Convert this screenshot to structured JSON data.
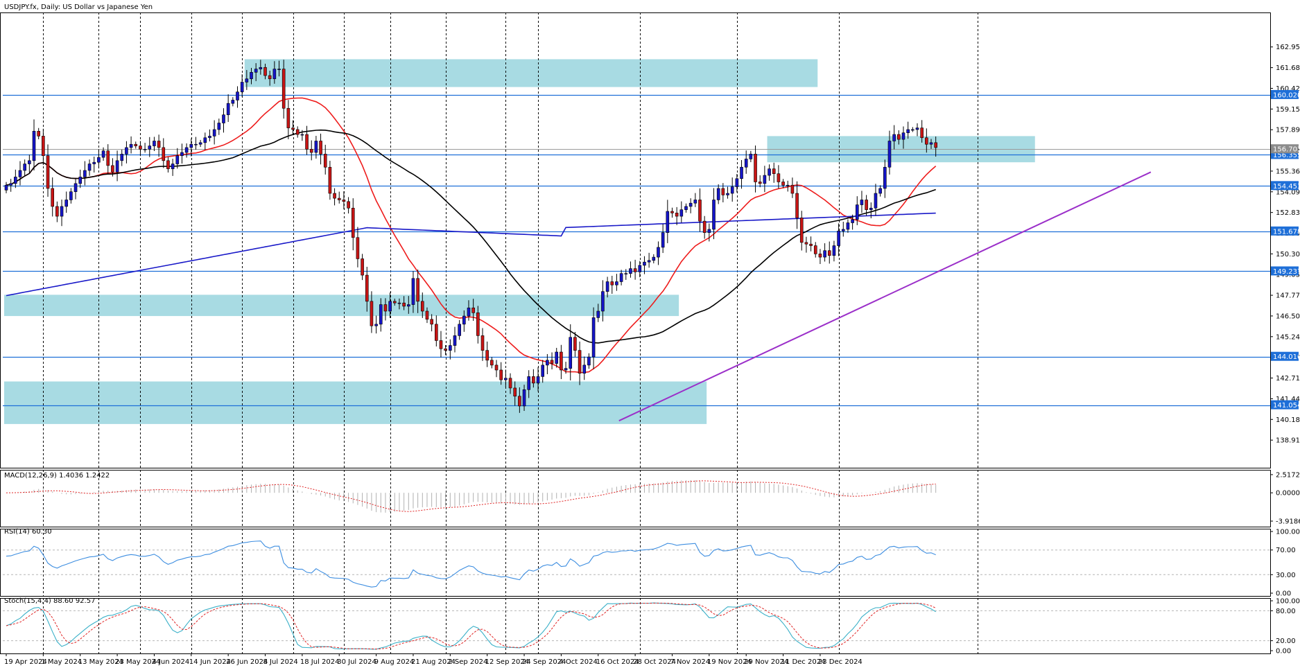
{
  "title": "USDJPY.fx, Daily:  US Dollar vs Japanese Yen",
  "colors": {
    "bull": "#1515c8",
    "bear": "#c81515",
    "zone": "#a8dbe3",
    "level": "#1e6fd8",
    "ma_fast": "#ee1c1c",
    "ma_mid": "#000000",
    "ma_slow": "#1818c8",
    "trend": "#9b2fc9",
    "rsi": "#3c8de0",
    "stoch_main": "#3ab0c8",
    "stoch_signal": "#e02424",
    "macd_hist": "#b0b0b0",
    "macd_signal": "#e02424"
  },
  "chart_data": {
    "type": "candlestick",
    "symbol": "USDJPY.fx",
    "timeframe": "Daily",
    "ylim": [
      137.65,
      164.21
    ],
    "y_ticks": [
      "162.950",
      "161.685",
      "160.420",
      "159.155",
      "157.890",
      "156.625",
      "155.360",
      "154.095",
      "152.830",
      "151.565",
      "150.300",
      "149.035",
      "147.770",
      "146.505",
      "145.240",
      "143.975",
      "142.710",
      "141.445",
      "140.180",
      "138.915"
    ],
    "x_labels": [
      {
        "i": 0,
        "label": "19 Apr 2024"
      },
      {
        "i": 8,
        "label": "1 May 2024"
      },
      {
        "i": 16,
        "label": "13 May 2024"
      },
      {
        "i": 24,
        "label": "23 May 2024"
      },
      {
        "i": 32,
        "label": "4 Jun 2024"
      },
      {
        "i": 40,
        "label": "14 Jun 2024"
      },
      {
        "i": 48,
        "label": "26 Jun 2024"
      },
      {
        "i": 56,
        "label": "8 Jul 2024"
      },
      {
        "i": 64,
        "label": "18 Jul 2024"
      },
      {
        "i": 72,
        "label": "30 Jul 2024"
      },
      {
        "i": 80,
        "label": "9 Aug 2024"
      },
      {
        "i": 88,
        "label": "21 Aug 2024"
      },
      {
        "i": 96,
        "label": "2 Sep 2024"
      },
      {
        "i": 104,
        "label": "12 Sep 2024"
      },
      {
        "i": 112,
        "label": "24 Sep 2024"
      },
      {
        "i": 120,
        "label": "4 Oct 2024"
      },
      {
        "i": 128,
        "label": "16 Oct 2024"
      },
      {
        "i": 136,
        "label": "28 Oct 2024"
      },
      {
        "i": 144,
        "label": "7 Nov 2024"
      },
      {
        "i": 152,
        "label": "19 Nov 2024"
      },
      {
        "i": 160,
        "label": "29 Nov 2024"
      },
      {
        "i": 168,
        "label": "11 Dec 2024"
      },
      {
        "i": 176,
        "label": "23 Dec 2024"
      }
    ],
    "vgrid_i": [
      8,
      20,
      29,
      40,
      51,
      62,
      73,
      83,
      95,
      108,
      115,
      137,
      158,
      180,
      210
    ],
    "closes": [
      154.5,
      154.6,
      155.0,
      155.4,
      155.8,
      156.0,
      157.8,
      157.5,
      156.3,
      154.3,
      153.2,
      152.6,
      153.2,
      153.6,
      154.1,
      154.6,
      155.0,
      155.4,
      155.8,
      155.9,
      156.2,
      156.6,
      155.7,
      155.3,
      156.0,
      156.4,
      156.8,
      157.0,
      156.9,
      156.7,
      156.7,
      156.9,
      157.2,
      156.8,
      156.0,
      155.5,
      155.8,
      156.3,
      156.5,
      156.8,
      157.0,
      157.0,
      157.1,
      157.4,
      157.5,
      157.9,
      158.3,
      158.8,
      159.5,
      159.7,
      160.2,
      160.8,
      161.0,
      161.4,
      161.6,
      161.7,
      161.2,
      161.0,
      161.6,
      161.6,
      159.2,
      158.0,
      157.9,
      157.6,
      157.6,
      156.7,
      156.5,
      157.2,
      156.4,
      155.6,
      154.0,
      153.7,
      153.6,
      153.5,
      153.1,
      151.3,
      150.0,
      149.0,
      147.4,
      145.9,
      146.0,
      147.2,
      146.8,
      147.4,
      147.3,
      147.3,
      147.1,
      147.2,
      148.8,
      147.4,
      146.8,
      146.3,
      146.0,
      145.0,
      144.5,
      144.4,
      144.7,
      145.3,
      146.0,
      146.5,
      147.0,
      146.7,
      145.3,
      144.4,
      143.8,
      143.5,
      143.2,
      142.6,
      142.7,
      142.1,
      141.6,
      141.0,
      142.0,
      142.8,
      142.4,
      142.8,
      143.5,
      143.8,
      143.6,
      144.3,
      143.2,
      143.3,
      145.2,
      144.4,
      143.0,
      143.5,
      144.0,
      146.4,
      146.8,
      148.0,
      148.6,
      148.4,
      148.6,
      149.1,
      149.1,
      149.4,
      149.2,
      149.6,
      149.8,
      149.9,
      150.1,
      150.7,
      151.6,
      152.9,
      152.8,
      152.6,
      153.0,
      153.2,
      153.4,
      153.6,
      152.3,
      151.6,
      151.8,
      153.6,
      154.3,
      153.9,
      154.0,
      154.4,
      154.9,
      155.6,
      156.1,
      156.4,
      154.7,
      154.6,
      155.1,
      155.5,
      155.2,
      154.7,
      154.5,
      154.5,
      154.0,
      152.5,
      151.0,
      150.9,
      150.8,
      150.3,
      150.1,
      150.5,
      150.2,
      150.8,
      151.7,
      151.8,
      152.2,
      152.4,
      153.3,
      153.6,
      153.0,
      153.1,
      154.0,
      154.3,
      155.6,
      157.2,
      157.6,
      157.3,
      157.7,
      157.9,
      157.9,
      158.0,
      157.4,
      157.0,
      157.1,
      156.8
    ],
    "candles_drawn": 197,
    "ma_periods": {
      "fast": 20,
      "mid": 50,
      "slow": 200
    },
    "levels": [
      {
        "value": 160.02,
        "label": "160.020"
      },
      {
        "value": 156.355,
        "label": "156.355"
      },
      {
        "value": 154.453,
        "label": "154.453"
      },
      {
        "value": 151.678,
        "label": "151.678"
      },
      {
        "value": 149.237,
        "label": "149.237"
      },
      {
        "value": 144.016,
        "label": "144.016"
      },
      {
        "value": 141.054,
        "label": "141.054"
      }
    ],
    "last_price": {
      "value": 156.703,
      "label": "156.703"
    },
    "zones": [
      {
        "i0": 52,
        "i1": 175,
        "y0": 160.5,
        "y1": 162.2
      },
      {
        "i0": 165,
        "i1": 222,
        "y0": 155.9,
        "y1": 157.5
      },
      {
        "i0": 0,
        "i1": 145,
        "y0": 146.5,
        "y1": 147.8
      },
      {
        "i0": 0,
        "i1": 151,
        "y0": 139.9,
        "y1": 142.5
      }
    ],
    "trendline": {
      "x0": 132.5,
      "y0": 140.1,
      "x1": 247.5,
      "y1": 155.3
    },
    "indicators": {
      "macd": {
        "label": "MACD(12,26,9) 1.4036 1.2422",
        "ticks": [
          "2.5172",
          "0.0000",
          "-3.9186"
        ],
        "tick_values": [
          2.5172,
          0,
          -3.9186
        ],
        "ylim": [
          -4.3,
          2.8
        ],
        "current": {
          "main": 1.4036,
          "signal": 1.2422
        }
      },
      "rsi": {
        "label": "RSI(14) 60.30",
        "ticks": [
          "100.00",
          "70.00",
          "30.00",
          "0.00"
        ],
        "tick_values": [
          100,
          70,
          30,
          0
        ],
        "levels": [
          70,
          30
        ],
        "ylim": [
          0,
          100
        ],
        "current": 60.3
      },
      "stoch": {
        "label": "Stoch(15,4,4) 88.60 92.57",
        "ticks": [
          "100.00",
          "80.00",
          "20.00",
          "0.00"
        ],
        "tick_values": [
          100,
          80,
          20,
          0
        ],
        "levels": [
          80,
          20
        ],
        "ylim": [
          0,
          100
        ],
        "current": {
          "main": 88.6,
          "signal": 92.57
        }
      }
    }
  }
}
